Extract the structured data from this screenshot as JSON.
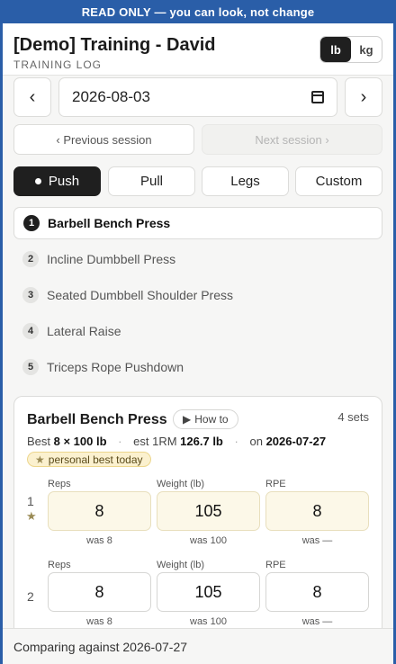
{
  "banner": "READ ONLY — you can look, not change",
  "header": {
    "title": "[Demo] Training - David",
    "subtitle": "TRAINING LOG",
    "units": [
      {
        "label": "lb",
        "active": true
      },
      {
        "label": "kg",
        "active": false
      }
    ]
  },
  "date_nav": {
    "prev_glyph": "‹",
    "next_glyph": "›",
    "date_value": "2026-08-03",
    "calendar_icon": "calendar-icon"
  },
  "session_nav": {
    "previous": "‹ Previous session",
    "next": "Next session ›",
    "next_disabled": true
  },
  "day_tabs": [
    {
      "label": "Push",
      "active": true
    },
    {
      "label": "Pull",
      "active": false
    },
    {
      "label": "Legs",
      "active": false
    },
    {
      "label": "Custom",
      "active": false
    }
  ],
  "exercises": [
    {
      "num": "1",
      "name": "Barbell Bench Press",
      "active": true
    },
    {
      "num": "2",
      "name": "Incline Dumbbell Press",
      "active": false
    },
    {
      "num": "3",
      "name": "Seated Dumbbell Shoulder Press",
      "active": false
    },
    {
      "num": "4",
      "name": "Lateral Raise",
      "active": false
    },
    {
      "num": "5",
      "name": "Triceps Rope Pushdown",
      "active": false
    }
  ],
  "card": {
    "title": "Barbell Bench Press",
    "howto": "How to",
    "howto_icon": "play-icon",
    "sets_count": "4 sets",
    "best_label": "Best",
    "best_value": "8 × 100 lb",
    "est_label": "est 1RM",
    "est_value": "126.7 lb",
    "on_label": "on",
    "on_value": "2026-07-27",
    "pb_badge": "personal best today",
    "pb_icon": "star-icon",
    "col_labels": {
      "reps": "Reps",
      "weight": "Weight (lb)",
      "rpe": "RPE"
    },
    "sets": [
      {
        "num": "1",
        "pb": true,
        "reps": "8",
        "weight": "105",
        "rpe": "8",
        "was_reps": "was 8",
        "was_weight": "was 100",
        "was_rpe": "was —"
      },
      {
        "num": "2",
        "pb": false,
        "reps": "8",
        "weight": "105",
        "rpe": "8",
        "was_reps": "was 8",
        "was_weight": "was 100",
        "was_rpe": "was —"
      }
    ]
  },
  "footer": {
    "text": "Comparing against 2026-07-27"
  },
  "colors": {
    "frame_blue": "#2a5ea8",
    "active_dark": "#1f1f1f",
    "pb_fill": "#fcf8e8",
    "badge_fill": "#fbf1cf"
  }
}
